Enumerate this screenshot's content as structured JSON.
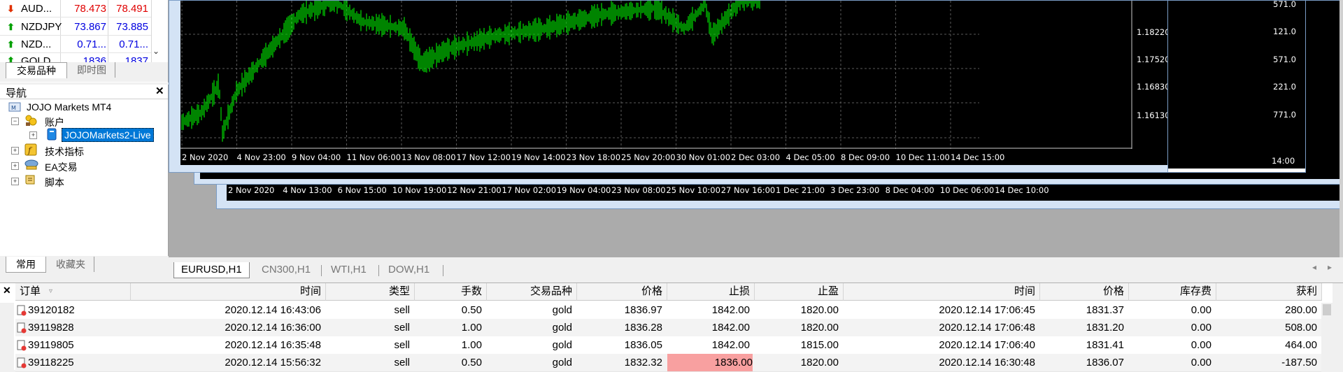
{
  "market_watch": {
    "rows": [
      {
        "symbol": "AUD...",
        "bid": "78.473",
        "ask": "78.491",
        "direction": "down"
      },
      {
        "symbol": "NZDJPY",
        "bid": "73.867",
        "ask": "73.885",
        "direction": "up"
      },
      {
        "symbol": "NZD...",
        "bid": "0.71...",
        "ask": "0.71...",
        "direction": "up"
      },
      {
        "symbol": "GOLD",
        "bid": "1836",
        "ask": "1837",
        "direction": "up"
      }
    ],
    "tabs": [
      "交易品种",
      "即时图"
    ]
  },
  "navigator": {
    "title": "导航",
    "root": "JOJO Markets MT4",
    "accounts": "账户",
    "account": "JOJOMarkets2-Live",
    "indicators": "技术指标",
    "ea": "EA交易",
    "scripts": "脚本",
    "tabs": [
      "常用",
      "收藏夹"
    ]
  },
  "chart_front": {
    "x_labels": [
      "2 Nov 2020",
      "4 Nov 23:00",
      "9 Nov 04:00",
      "11 Nov 06:00",
      "13 Nov 08:00",
      "17 Nov 12:00",
      "19 Nov 14:00",
      "23 Nov 18:00",
      "25 Nov 20:00",
      "30 Nov 01:00",
      "2 Dec 03:00",
      "4 Dec 05:00",
      "8 Dec 09:00",
      "10 Dec 11:00",
      "14 Dec 15:00"
    ],
    "y_labels": [
      "1.18220",
      "1.17520",
      "1.16830",
      "1.16130"
    ]
  },
  "chart_back": {
    "x_labels": [
      "2 Nov 2020",
      "4 Nov 13:00",
      "6 Nov 15:00",
      "10 Nov 19:00",
      "12 Nov 21:00",
      "17 Nov 02:00",
      "19 Nov 04:00",
      "23 Nov 08:00",
      "25 Nov 10:00",
      "27 Nov 16:00",
      "1 Dec 21:00",
      "3 Dec 23:00",
      "8 Dec 04:00",
      "10 Dec 06:00",
      "14 Dec 10:00"
    ]
  },
  "chart_right": {
    "y_labels": [
      "571.0",
      "121.0",
      "571.0",
      "221.0",
      "771.0"
    ],
    "x_label": "14:00"
  },
  "chart_tabs": [
    "EURUSD,H1",
    "CN300,H1",
    "WTI,H1",
    "DOW,H1"
  ],
  "terminal": {
    "headers": [
      "订单",
      "时间",
      "类型",
      "手数",
      "交易品种",
      "价格",
      "止损",
      "止盈",
      "时间",
      "价格",
      "库存费",
      "获利"
    ],
    "rows": [
      [
        "39120182",
        "2020.12.14 16:43:06",
        "sell",
        "0.50",
        "gold",
        "1836.97",
        "1842.00",
        "1820.00",
        "2020.12.14 17:06:45",
        "1831.37",
        "0.00",
        "280.00"
      ],
      [
        "39119828",
        "2020.12.14 16:36:00",
        "sell",
        "1.00",
        "gold",
        "1836.28",
        "1842.00",
        "1820.00",
        "2020.12.14 17:06:48",
        "1831.20",
        "0.00",
        "508.00"
      ],
      [
        "39119805",
        "2020.12.14 16:35:48",
        "sell",
        "1.00",
        "gold",
        "1836.05",
        "1842.00",
        "1815.00",
        "2020.12.14 17:06:40",
        "1831.41",
        "0.00",
        "464.00"
      ],
      [
        "39118225",
        "2020.12.14 15:56:32",
        "sell",
        "0.50",
        "gold",
        "1832.32",
        "1836.00",
        "1820.00",
        "2020.12.14 16:30:48",
        "1836.07",
        "0.00",
        "-187.50"
      ]
    ]
  },
  "colors": {
    "chart_bg": "#000000",
    "candles": "#00cc00",
    "up": "#00a000",
    "down": "#e03000",
    "bid_down": "#e00000",
    "bid_up": "#0000e0",
    "stop_highlight": "#f8a0a0"
  }
}
